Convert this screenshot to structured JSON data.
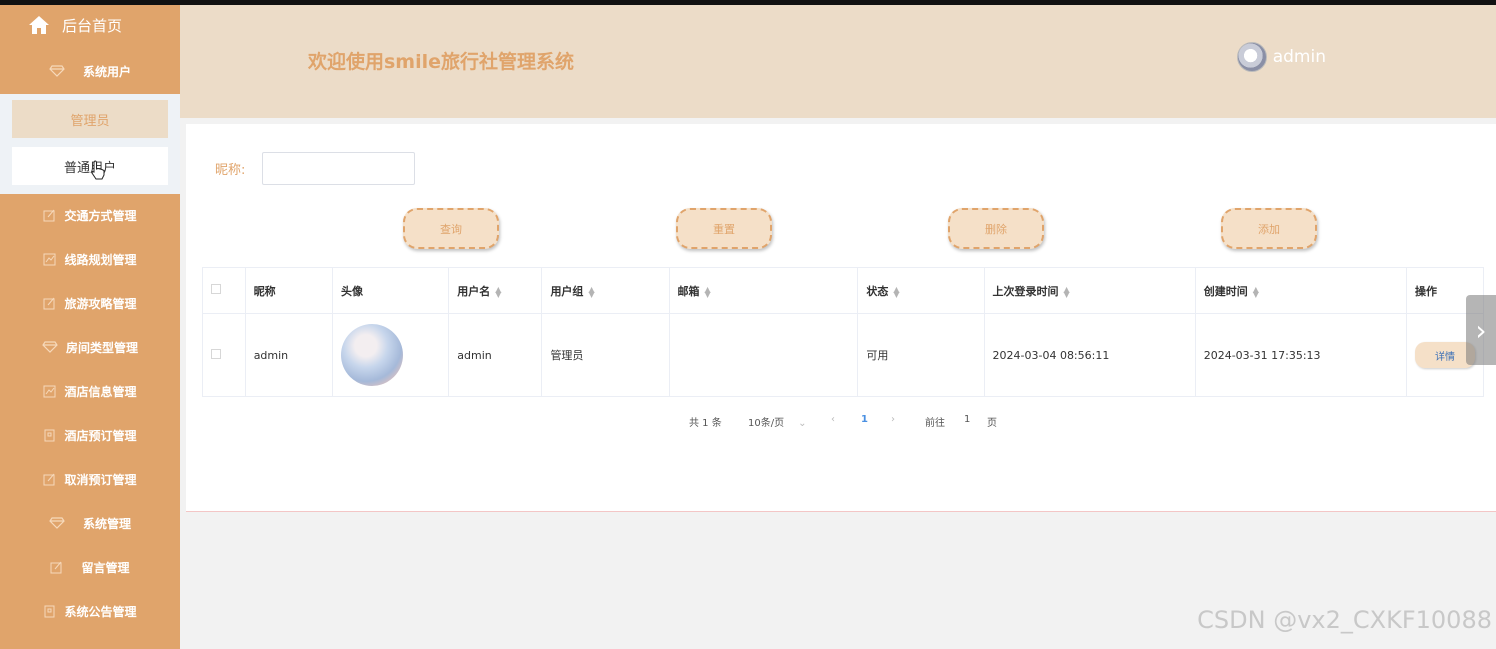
{
  "sidebar": {
    "home_label": "后台首页",
    "system_user_label": "系统用户",
    "submenu": [
      "管理员",
      "普通用户"
    ],
    "items": [
      {
        "label": "交通方式管理",
        "icon": "edit-icon"
      },
      {
        "label": "线路规划管理",
        "icon": "chart-icon"
      },
      {
        "label": "旅游攻略管理",
        "icon": "edit-icon"
      },
      {
        "label": "房间类型管理",
        "icon": "gem-icon"
      },
      {
        "label": "酒店信息管理",
        "icon": "chart-icon"
      },
      {
        "label": "酒店预订管理",
        "icon": "doc-icon"
      },
      {
        "label": "取消预订管理",
        "icon": "edit-icon"
      },
      {
        "label": "系统管理",
        "icon": "gem-icon"
      },
      {
        "label": "留言管理",
        "icon": "edit-icon"
      },
      {
        "label": "系统公告管理",
        "icon": "doc-icon"
      }
    ]
  },
  "header": {
    "title": "欢迎使用smile旅行社管理系统",
    "username": "admin"
  },
  "search": {
    "label": "昵称:",
    "value": ""
  },
  "buttons": {
    "query": "查询",
    "reset": "重置",
    "delete": "删除",
    "add": "添加"
  },
  "table": {
    "columns": [
      "昵称",
      "头像",
      "用户名",
      "用户组",
      "邮箱",
      "状态",
      "上次登录时间",
      "创建时间",
      "操作"
    ],
    "rows": [
      {
        "nickname": "admin",
        "username": "admin",
        "group": "管理员",
        "email": "",
        "status": "可用",
        "last_login": "2024-03-04 08:56:11",
        "created": "2024-03-31 17:35:13",
        "action": "详情"
      }
    ]
  },
  "pagination": {
    "total": "共 1 条",
    "page_size": "10条/页",
    "current_page": "1",
    "goto_label": "前往",
    "goto_value": "1",
    "page_suffix": "页"
  },
  "watermark": "CSDN @vx2_CXKF10088",
  "colors": {
    "accent": "#e0a46b",
    "header_bg": "#ecdcc8"
  }
}
